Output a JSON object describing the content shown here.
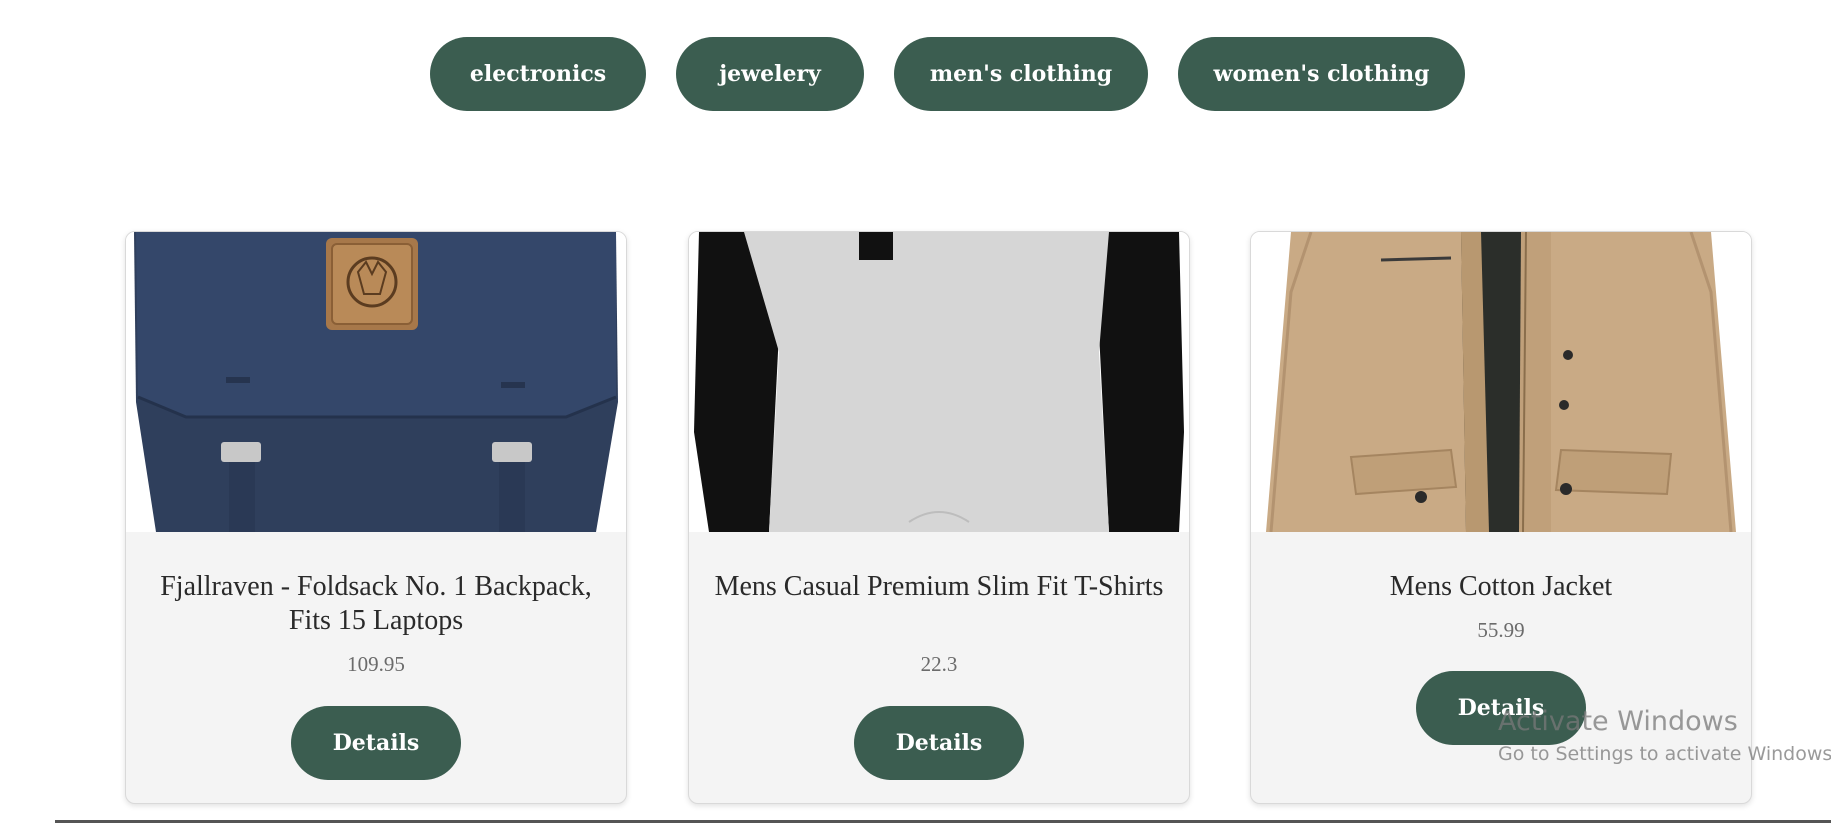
{
  "categories": [
    {
      "label": "electronics"
    },
    {
      "label": "jewelery"
    },
    {
      "label": "men's clothing"
    },
    {
      "label": "women's clothing"
    }
  ],
  "products": [
    {
      "title": "Fjallraven - Foldsack No. 1 Backpack, Fits 15 Laptops",
      "price": "109.95",
      "button": "Details",
      "image_icon": "backpack-image"
    },
    {
      "title": "Mens Casual Premium Slim Fit T-Shirts",
      "price": "22.3",
      "button": "Details",
      "image_icon": "tshirt-image"
    },
    {
      "title": "Mens Cotton Jacket",
      "price": "55.99",
      "button": "Details",
      "image_icon": "jacket-image"
    }
  ],
  "watermark": {
    "title": "Activate Windows",
    "subtitle": "Go to Settings to activate Windows."
  },
  "colors": {
    "accent": "#3b5d50",
    "card_bg": "#f4f4f4",
    "price_text": "#6b6b6b"
  }
}
